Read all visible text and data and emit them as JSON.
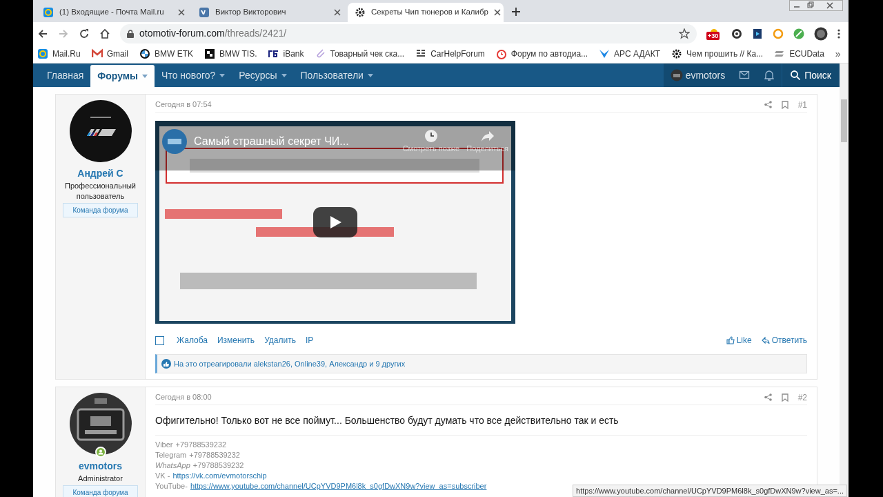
{
  "browser": {
    "tabs": [
      {
        "title": "(1) Входящие - Почта Mail.ru",
        "selected": false
      },
      {
        "title": "Виктор Викторович",
        "selected": false
      },
      {
        "title": "Секреты Чип тюнеров и Калибр",
        "selected": true
      }
    ],
    "url_host": "otomotiv-forum.com",
    "url_path": "/threads/2421/",
    "extension_badge": "+30",
    "bookmarks": [
      "Mail.Ru",
      "Gmail",
      "BMW ETK",
      "BMW TIS.",
      "iBank",
      "Товарный чек ска...",
      "CarHelpForum",
      "Форум по автодиа...",
      "APC АДАКТ",
      "Чем прошить // Ка...",
      "ECUData"
    ],
    "bookmarks_more": "»"
  },
  "nav": {
    "items": [
      {
        "label": "Главная",
        "selected": false,
        "dropdown": false
      },
      {
        "label": "Форумы",
        "selected": true,
        "dropdown": true
      },
      {
        "label": "Что нового?",
        "selected": false,
        "dropdown": true
      },
      {
        "label": "Ресурсы",
        "selected": false,
        "dropdown": true
      },
      {
        "label": "Пользователи",
        "selected": false,
        "dropdown": true
      }
    ],
    "user": "evmotors",
    "search": "Поиск"
  },
  "posts": [
    {
      "author": "Андрей С",
      "title": "Профессиональный пользователь",
      "badge": "Команда форума",
      "online": false,
      "checked": false,
      "time": "Сегодня в 07:54",
      "number": "#1",
      "video": {
        "title": "Самый страшный секрет ЧИ...",
        "watch_later": "Смотреть позже",
        "share": "Поделиться"
      },
      "actions": [
        "Жалоба",
        "Изменить",
        "Удалить",
        "IP"
      ],
      "like": "Like",
      "reply": "Ответить",
      "reactions": "На это отреагировали alekstan26, Online39, Александр и 9 других"
    },
    {
      "author": "evmotors",
      "title": "Administrator",
      "badge": "Команда форума",
      "online": true,
      "time": "Сегодня в 08:00",
      "number": "#2",
      "text": "Офигительно! Только вот не все поймут... Большенство будут думать что все действительно так и есть",
      "signature": [
        {
          "label": "Viber",
          "italic": false,
          "value": "+79788539232",
          "link": false
        },
        {
          "label": "Telegram",
          "italic": false,
          "value": "+79788539232",
          "link": false
        },
        {
          "label": "WhatsApp",
          "italic": true,
          "value": "+79788539232",
          "link": false
        },
        {
          "label": "VK -",
          "italic": false,
          "value": "https://vk.com/evmotorschip",
          "link": true
        },
        {
          "label": "YouTube-",
          "italic": false,
          "value": "https://www.youtube.com/channel/UCpYVD9PM6l8k_s0gfDwXN9w?view_as=subscriber",
          "link": true
        }
      ]
    }
  ],
  "status_url": "https://www.youtube.com/channel/UCpYVD9PM6l8k_s0gfDwXN9w?view_as=..."
}
